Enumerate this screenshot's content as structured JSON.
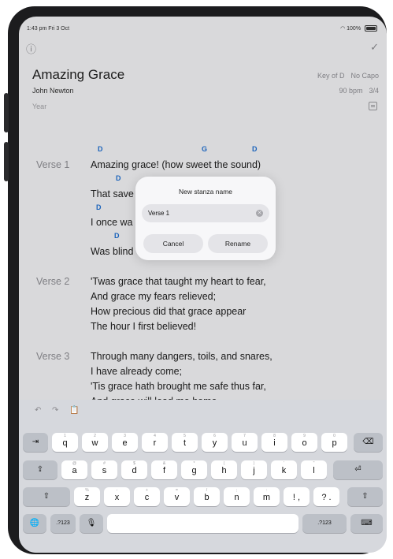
{
  "status": {
    "time": "1:43 pm  Fri 3 Oct",
    "battery": "100%"
  },
  "top": {
    "info_icon": "ⓘ",
    "done_icon": "✓"
  },
  "song": {
    "title": "Amazing Grace",
    "author": "John Newton",
    "year_placeholder": "Year",
    "key": "Key of D",
    "capo": "No Capo",
    "bpm": "90 bpm",
    "time_sig": "3/4"
  },
  "verses": [
    {
      "label": "Verse 1",
      "lines": [
        "Amazing grace! (how sweet the sound)",
        "That save",
        "I once wa",
        "Was blind"
      ]
    },
    {
      "label": "Verse 2",
      "lines": [
        "'Twas grace that taught my heart to fear,",
        "And grace my fears relieved;",
        "How precious did that grace appear",
        "The hour I first believed!"
      ]
    },
    {
      "label": "Verse 3",
      "lines": [
        "Through many dangers, toils, and snares,",
        "I have already come;",
        "'Tis grace hath brought me safe thus far,",
        "And grace will lead me home."
      ]
    }
  ],
  "chords": [
    "D",
    "G",
    "D",
    "D",
    "D",
    "D"
  ],
  "dialog": {
    "title": "New stanza name",
    "input_value": "Verse 1",
    "cancel_label": "Cancel",
    "rename_label": "Rename"
  },
  "keyboard": {
    "toolbar": {
      "undo": "↶",
      "redo": "↷",
      "paste": "📋"
    },
    "row1": [
      {
        "k": "q",
        "a": "1"
      },
      {
        "k": "w",
        "a": "2"
      },
      {
        "k": "e",
        "a": "3"
      },
      {
        "k": "r",
        "a": "4"
      },
      {
        "k": "t",
        "a": "5"
      },
      {
        "k": "y",
        "a": "6"
      },
      {
        "k": "u",
        "a": "7"
      },
      {
        "k": "i",
        "a": "8"
      },
      {
        "k": "o",
        "a": "9"
      },
      {
        "k": "p",
        "a": "0"
      }
    ],
    "row2": [
      {
        "k": "a",
        "a": "@"
      },
      {
        "k": "s",
        "a": "#"
      },
      {
        "k": "d",
        "a": "$"
      },
      {
        "k": "f",
        "a": "&"
      },
      {
        "k": "g",
        "a": "*"
      },
      {
        "k": "h",
        "a": "("
      },
      {
        "k": "j",
        "a": ")"
      },
      {
        "k": "k",
        "a": "'"
      },
      {
        "k": "l",
        "a": "\""
      }
    ],
    "row3": [
      {
        "k": "z",
        "a": "%"
      },
      {
        "k": "x",
        "a": "-"
      },
      {
        "k": "c",
        "a": "+"
      },
      {
        "k": "v",
        "a": "="
      },
      {
        "k": "b",
        "a": "/"
      },
      {
        "k": "n",
        "a": ";"
      },
      {
        "k": "m",
        "a": ":"
      },
      {
        "k": "!\n,",
        "a": ""
      },
      {
        "k": "?\n.",
        "a": ""
      }
    ],
    "tab_label": "⇥",
    "delete_label": "⌫",
    "caps_label": "⇪",
    "return_label": "⏎",
    "shift_label": "⇧",
    "globe_label": "🌐",
    "numbers_label": ".?123",
    "mic_label": "🎙",
    "dismiss_label": "⌨"
  }
}
